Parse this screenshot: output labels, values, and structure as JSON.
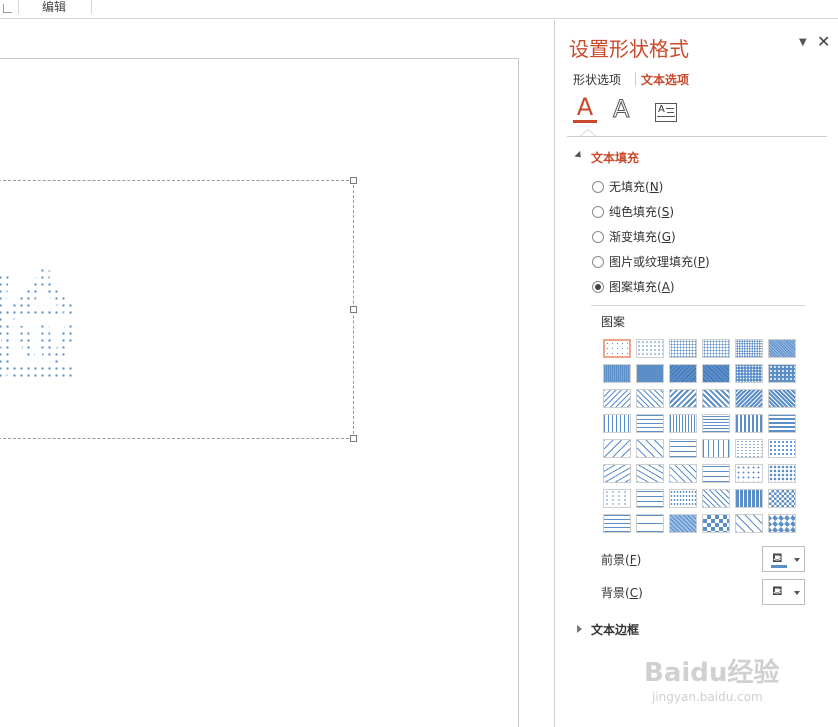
{
  "ribbon": {
    "group_label": "编辑"
  },
  "slide": {
    "text": "验"
  },
  "panel": {
    "title": "设置形状格式",
    "tabs": [
      "形状选项",
      "文本选项"
    ],
    "icons": {
      "fill_icon": "text-fill-icon",
      "outline_icon": "text-outline-icon",
      "textbox_icon": "textbox-icon"
    },
    "textbox_icon_glyph": "A",
    "text_fill_section": "文本填充",
    "fill_options": [
      {
        "label": "无填充(",
        "key": "N",
        "end": ")"
      },
      {
        "label": "纯色填充(",
        "key": "S",
        "end": ")"
      },
      {
        "label": "渐变填充(",
        "key": "G",
        "end": ")"
      },
      {
        "label": "图片或纹理填充(",
        "key": "P",
        "end": ")"
      },
      {
        "label": "图案填充(",
        "key": "A",
        "end": ")"
      }
    ],
    "selected_fill": "图案填充",
    "pattern_label": "图案",
    "foreground_label": "前景(",
    "foreground_key": "F",
    "background_label": "背景(",
    "background_key": "C",
    "close_end": ")",
    "text_border_section": "文本边框"
  },
  "colors": {
    "accent": "#c94a2b",
    "pattern_blue": "#5c8ec8"
  },
  "watermark": {
    "brand": "Baidu经验",
    "url": "jingyan.baidu.com"
  }
}
